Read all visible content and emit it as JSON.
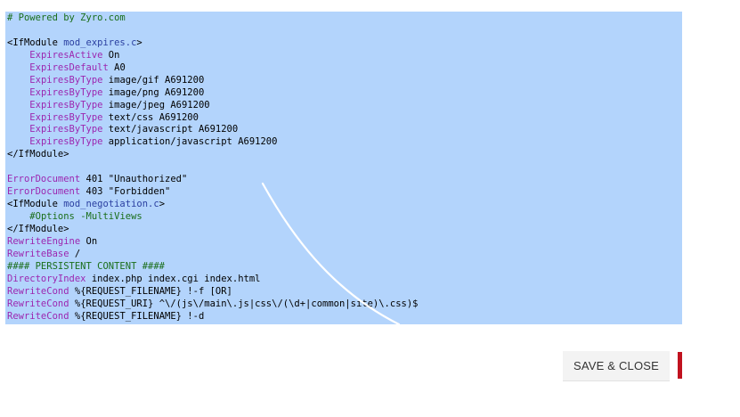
{
  "editor": {
    "lines": [
      [
        {
          "t": "# Powered by Zyro.com",
          "c": "comment"
        }
      ],
      [],
      [
        {
          "t": "<IfModule ",
          "c": "tag"
        },
        {
          "t": "mod_expires.c",
          "c": "module"
        },
        {
          "t": ">",
          "c": "tag"
        }
      ],
      [
        {
          "t": "    ",
          "c": "normal"
        },
        {
          "t": "ExpiresActive",
          "c": "directive"
        },
        {
          "t": " On",
          "c": "normal"
        }
      ],
      [
        {
          "t": "    ",
          "c": "normal"
        },
        {
          "t": "ExpiresDefault",
          "c": "directive"
        },
        {
          "t": " A0",
          "c": "normal"
        }
      ],
      [
        {
          "t": "    ",
          "c": "normal"
        },
        {
          "t": "ExpiresByType",
          "c": "directive"
        },
        {
          "t": " image/gif A691200",
          "c": "normal"
        }
      ],
      [
        {
          "t": "    ",
          "c": "normal"
        },
        {
          "t": "ExpiresByType",
          "c": "directive"
        },
        {
          "t": " image/png A691200",
          "c": "normal"
        }
      ],
      [
        {
          "t": "    ",
          "c": "normal"
        },
        {
          "t": "ExpiresByType",
          "c": "directive"
        },
        {
          "t": " image/jpeg A691200",
          "c": "normal"
        }
      ],
      [
        {
          "t": "    ",
          "c": "normal"
        },
        {
          "t": "ExpiresByType",
          "c": "directive"
        },
        {
          "t": " text/css A691200",
          "c": "normal"
        }
      ],
      [
        {
          "t": "    ",
          "c": "normal"
        },
        {
          "t": "ExpiresByType",
          "c": "directive"
        },
        {
          "t": " text/javascript A691200",
          "c": "normal"
        }
      ],
      [
        {
          "t": "    ",
          "c": "normal"
        },
        {
          "t": "ExpiresByType",
          "c": "directive"
        },
        {
          "t": " application/javascript A691200",
          "c": "normal"
        }
      ],
      [
        {
          "t": "</IfModule>",
          "c": "tag"
        }
      ],
      [],
      [
        {
          "t": "ErrorDocument",
          "c": "directive"
        },
        {
          "t": " 401 \"Unauthorized\"",
          "c": "normal"
        }
      ],
      [
        {
          "t": "ErrorDocument",
          "c": "directive"
        },
        {
          "t": " 403 \"Forbidden\"",
          "c": "normal"
        }
      ],
      [
        {
          "t": "<IfModule ",
          "c": "tag"
        },
        {
          "t": "mod_negotiation.c",
          "c": "module"
        },
        {
          "t": ">",
          "c": "tag"
        }
      ],
      [
        {
          "t": "    ",
          "c": "normal"
        },
        {
          "t": "#Options -MultiViews",
          "c": "comment"
        }
      ],
      [
        {
          "t": "</IfModule>",
          "c": "tag"
        }
      ],
      [
        {
          "t": "RewriteEngine",
          "c": "directive"
        },
        {
          "t": " On",
          "c": "normal"
        }
      ],
      [
        {
          "t": "RewriteBase",
          "c": "directive"
        },
        {
          "t": " /",
          "c": "normal"
        }
      ],
      [
        {
          "t": "#### PERSISTENT CONTENT ####",
          "c": "comment"
        }
      ],
      [
        {
          "t": "DirectoryIndex",
          "c": "directive"
        },
        {
          "t": " index.php index.cgi index.html",
          "c": "normal"
        }
      ],
      [
        {
          "t": "RewriteCond",
          "c": "directive"
        },
        {
          "t": " %{REQUEST_FILENAME} !-f [OR]",
          "c": "normal"
        }
      ],
      [
        {
          "t": "RewriteCond",
          "c": "directive"
        },
        {
          "t": " %{REQUEST_URI} ^\\/(js\\/main\\.js|css\\/(\\d+|common|site)\\.css)$",
          "c": "normal"
        }
      ],
      [
        {
          "t": "RewriteCond",
          "c": "directive"
        },
        {
          "t": " %{REQUEST_FILENAME} !-d",
          "c": "normal"
        }
      ]
    ]
  },
  "actions": {
    "save_close_label": "SAVE & CLOSE"
  },
  "colors": {
    "selection": "#b3d4fc",
    "comment": "#1a6e1a",
    "directive": "#9c27b0",
    "module": "#2a3fa0",
    "accent": "#c1121f",
    "button_bg": "#f3f3f3"
  }
}
